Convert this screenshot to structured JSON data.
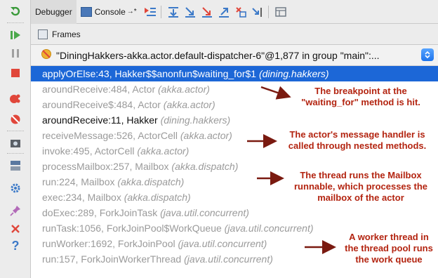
{
  "toolbar": {
    "tabs": [
      {
        "label": "Debugger",
        "active": true
      },
      {
        "label": "Console",
        "active": false,
        "suffix": "→*"
      }
    ]
  },
  "frames_panel": {
    "title": "Frames",
    "thread_selector": "\"DiningHakkers-akka.actor.default-dispatcher-6\"@1,877 in group \"main\":..."
  },
  "frames": [
    {
      "method": "applyOrElse:43, Hakker$$anonfun$waiting_for$1",
      "pkg": "(dining.hakkers)",
      "state": "selected"
    },
    {
      "method": "aroundReceive:484, Actor",
      "pkg": "(akka.actor)",
      "state": "library"
    },
    {
      "method": "aroundReceive$:484, Actor",
      "pkg": "(akka.actor)",
      "state": "library"
    },
    {
      "method": "aroundReceive:11, Hakker",
      "pkg": "(dining.hakkers)",
      "state": "project"
    },
    {
      "method": "receiveMessage:526, ActorCell",
      "pkg": "(akka.actor)",
      "state": "library"
    },
    {
      "method": "invoke:495, ActorCell",
      "pkg": "(akka.actor)",
      "state": "library"
    },
    {
      "method": "processMailbox:257, Mailbox",
      "pkg": "(akka.dispatch)",
      "state": "library"
    },
    {
      "method": "run:224, Mailbox",
      "pkg": "(akka.dispatch)",
      "state": "library"
    },
    {
      "method": "exec:234, Mailbox",
      "pkg": "(akka.dispatch)",
      "state": "library"
    },
    {
      "method": "doExec:289, ForkJoinTask",
      "pkg": "(java.util.concurrent)",
      "state": "library"
    },
    {
      "method": "runTask:1056, ForkJoinPool$WorkQueue",
      "pkg": "(java.util.concurrent)",
      "state": "library"
    },
    {
      "method": "runWorker:1692, ForkJoinPool",
      "pkg": "(java.util.concurrent)",
      "state": "library"
    },
    {
      "method": "run:157, ForkJoinWorkerThread",
      "pkg": "(java.util.concurrent)",
      "state": "library"
    }
  ],
  "annotations": {
    "breakpoint": [
      "The breakpoint at the",
      "\"waiting_for\" method is hit."
    ],
    "handler": [
      "The actor's message handler is",
      "called through nested methods."
    ],
    "mailbox": [
      "The thread runs the Mailbox",
      "runnable, which processes the",
      "mailbox of the actor"
    ],
    "worker": [
      "A worker thread in",
      "the thread pool runs",
      "the work queue"
    ]
  },
  "colors": {
    "selection": "#1c67d7",
    "annotation": "#b32410",
    "library_frame": "#9a9a9a",
    "project_frame": "#111111"
  }
}
